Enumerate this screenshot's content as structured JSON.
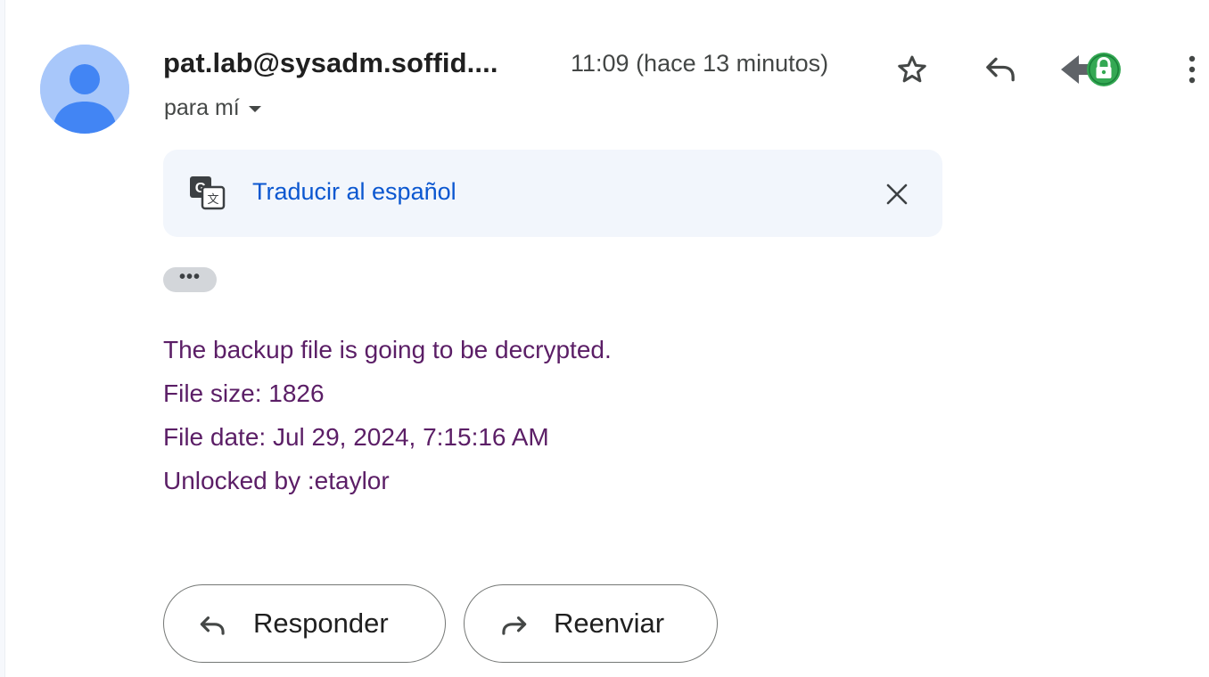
{
  "header": {
    "sender": "pat.lab@sysadm.soffid....",
    "timestamp": "11:09 (hace 13 minutos)",
    "recipient": "para mí"
  },
  "icons": {
    "avatar": "person-avatar-icon",
    "star": "star-outline-icon",
    "reply": "reply-icon",
    "addon": "lock-addon-icon",
    "more": "more-vertical-icon",
    "translate": "translate-icon",
    "close": "close-icon",
    "forward": "forward-icon"
  },
  "colors": {
    "avatar_bg": "#a8c7fa",
    "avatar_fg": "#4285f4",
    "link": "#0b57d0",
    "body_text": "#5b1e66",
    "lock_badge": "#34a853"
  },
  "translate_bar": {
    "label": "Traducir al español"
  },
  "trimmed_content": {
    "label": "•••"
  },
  "message": {
    "lines": [
      "The backup file is going to be decrypted.",
      "File size: 1826",
      "File date: Jul 29, 2024, 7:15:16 AM",
      "Unlocked by :etaylor"
    ]
  },
  "actions": {
    "reply_label": "Responder",
    "forward_label": "Reenviar"
  }
}
